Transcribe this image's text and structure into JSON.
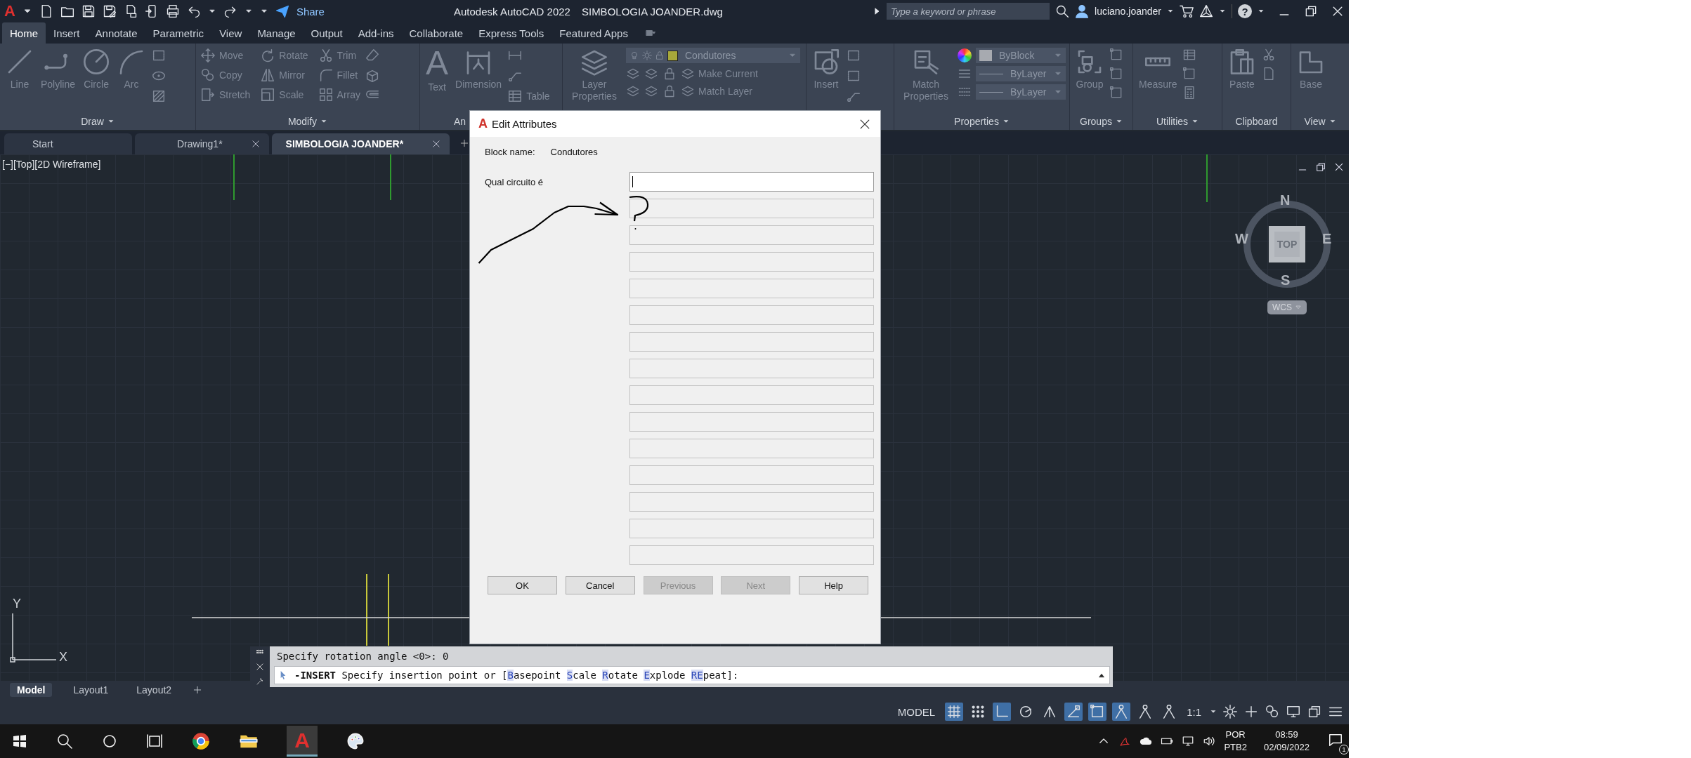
{
  "app": {
    "logo": "A"
  },
  "quick_access": {
    "share": "Share"
  },
  "window": {
    "app_title": "Autodesk AutoCAD 2022",
    "file_title": "SIMBOLOGIA JOANDER.dwg"
  },
  "search": {
    "placeholder": "Type a keyword or phrase"
  },
  "user": {
    "name": "luciano.joander"
  },
  "help": {
    "glyph": "?"
  },
  "ribbon_tabs": [
    {
      "label": "Home",
      "selected": true
    },
    {
      "label": "Insert",
      "selected": false
    },
    {
      "label": "Annotate",
      "selected": false
    },
    {
      "label": "Parametric",
      "selected": false
    },
    {
      "label": "View",
      "selected": false
    },
    {
      "label": "Manage",
      "selected": false
    },
    {
      "label": "Output",
      "selected": false
    },
    {
      "label": "Add-ins",
      "selected": false
    },
    {
      "label": "Collaborate",
      "selected": false
    },
    {
      "label": "Express Tools",
      "selected": false
    },
    {
      "label": "Featured Apps",
      "selected": false
    }
  ],
  "draw_panel": {
    "title": "Draw",
    "tools": [
      "Line",
      "Polyline",
      "Circle",
      "Arc"
    ]
  },
  "modify_panel": {
    "title": "Modify",
    "tools": [
      "Move",
      "Rotate",
      "Trim",
      "Copy",
      "Mirror",
      "Fillet",
      "Stretch",
      "Scale",
      "Array"
    ]
  },
  "annotation_panel": {
    "title": "An",
    "text_glyph": "A",
    "tools": [
      "Text",
      "Dimension"
    ],
    "table": "Table"
  },
  "layers_panel": {
    "tool": "Layer Properties",
    "layer": {
      "name": "Condutores",
      "color": "#a7a83a"
    },
    "make_current": "Make Current",
    "match_layer": "Match Layer"
  },
  "block_panel": {
    "tool": "Insert"
  },
  "properties_panel": {
    "title": "Properties",
    "tool": "Match Properties",
    "color_setting": "ByBlock",
    "linetype": "ByLayer",
    "lineweight": "ByLayer"
  },
  "groups_panel": {
    "title": "Groups",
    "tool": "Group"
  },
  "utilities_panel": {
    "title": "Utilities",
    "tool": "Measure"
  },
  "clipboard_panel": {
    "title": "Clipboard",
    "tool": "Paste"
  },
  "view_panel": {
    "title": "View",
    "tool": "Base"
  },
  "doc_tabs": [
    {
      "label": "Start",
      "selected": false,
      "closable": false
    },
    {
      "label": "Drawing1*",
      "selected": false,
      "closable": true
    },
    {
      "label": "SIMBOLOGIA JOANDER*",
      "selected": true,
      "closable": true
    }
  ],
  "viewport": {
    "label": "[−][Top][2D Wireframe]"
  },
  "viewcube": {
    "north": "N",
    "south": "S",
    "east": "E",
    "west": "W",
    "face": "TOP",
    "ucs": "WCS"
  },
  "ucs_icon": {
    "x": "X",
    "y": "Y"
  },
  "dialog": {
    "icon_glyph": "A",
    "title": "Edit Attributes",
    "block_name_label": "Block name:",
    "block_name": "Condutores",
    "fields": [
      {
        "label": "Qual circuito é",
        "enabled": true
      },
      {
        "enabled": false
      },
      {
        "enabled": false
      },
      {
        "enabled": false
      },
      {
        "enabled": false
      },
      {
        "enabled": false
      },
      {
        "enabled": false
      },
      {
        "enabled": false
      },
      {
        "enabled": false
      },
      {
        "enabled": false
      },
      {
        "enabled": false
      },
      {
        "enabled": false
      },
      {
        "enabled": false
      },
      {
        "enabled": false
      },
      {
        "enabled": false
      }
    ],
    "buttons": [
      {
        "label": "OK",
        "disabled": false
      },
      {
        "label": "Cancel",
        "disabled": false
      },
      {
        "label": "Previous",
        "disabled": true
      },
      {
        "label": "Next",
        "disabled": true
      },
      {
        "label": "Help",
        "disabled": false
      }
    ]
  },
  "command_line": {
    "history": "Specify rotation angle <0>: 0",
    "command": "-INSERT",
    "prompt": "Specify insertion point or [",
    "options": [
      {
        "key": "B",
        "rest": "asepoint"
      },
      {
        "key": "S",
        "rest": "cale"
      },
      {
        "key": "R",
        "rest": "otate"
      },
      {
        "key": "E",
        "rest": "xplode"
      },
      {
        "key": "RE",
        "rest": "peat"
      }
    ],
    "end": "]:"
  },
  "layout_tabs": [
    {
      "label": "Model",
      "selected": true
    },
    {
      "label": "Layout1",
      "selected": false
    },
    {
      "label": "Layout2",
      "selected": false
    }
  ],
  "status_bar": {
    "space": "MODEL",
    "scale": "1:1",
    "toggles": [
      {
        "on": true
      },
      {
        "on": false
      },
      {
        "on": true
      },
      {
        "on": false
      },
      {
        "on": false
      },
      {
        "on": true
      },
      {
        "on": true
      },
      {
        "on": true
      },
      {
        "on": false
      },
      {
        "on": false
      }
    ]
  },
  "taskbar": {
    "language": "POR",
    "layout": "PTB2",
    "time": "08:59",
    "date": "02/09/2022",
    "notifications": "1",
    "autocad_glyph": "A"
  }
}
